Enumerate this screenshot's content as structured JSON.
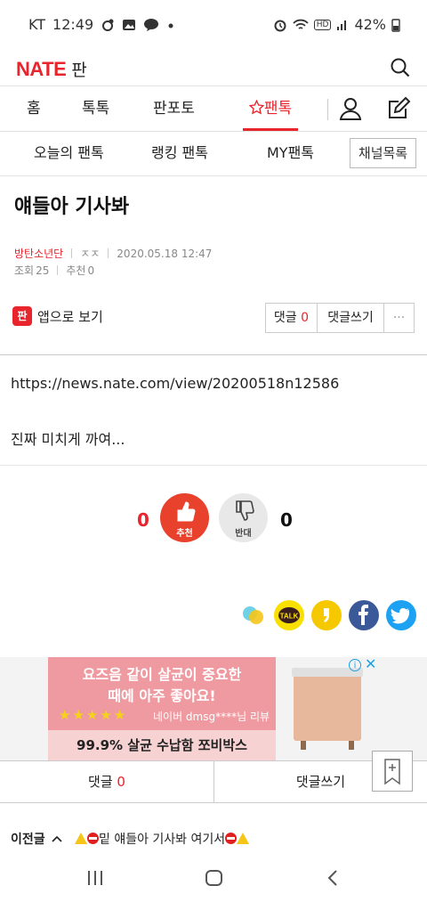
{
  "status_bar": {
    "carrier": "KT",
    "time": "12:49",
    "battery": "42%",
    "hd": "HD"
  },
  "header": {
    "logo": "NATE",
    "section": "판"
  },
  "nav": {
    "tabs": [
      "홈",
      "톡톡",
      "판포토",
      "팬톡"
    ],
    "active": "팬톡"
  },
  "subnav": {
    "tabs": [
      "오늘의 팬톡",
      "랭킹 팬톡",
      "MY팬톡"
    ],
    "channel_button": "채널목록"
  },
  "post": {
    "title": "얘들아 기사봐",
    "author": "방탄소년단",
    "nickname": "ㅈㅈ",
    "datetime": "2020.05.18 12:47",
    "views_label": "조회",
    "views": "25",
    "recommend_label": "추천",
    "recommend": "0",
    "app_view": "앱으로 보기",
    "comment_label": "댓글",
    "comment_count": "0",
    "write_comment": "댓글쓰기",
    "more": "···",
    "url": "https://news.nate.com/view/20200518n12586",
    "text": "진짜 미치게 까여..."
  },
  "votes": {
    "up_count": "0",
    "up_label": "추천",
    "down_count": "0",
    "down_label": "반대"
  },
  "share": {
    "icons": [
      "line-icon",
      "kakaotalk-icon",
      "kakaostory-icon",
      "facebook-icon",
      "twitter-icon"
    ],
    "talk_label": "TALK"
  },
  "ad": {
    "line1": "요즈음 같이 살균이 중요한",
    "line2": "때에 아주 좋아요!",
    "stars": "★★★★★",
    "review": "네이버 dmsg****님 리뷰",
    "line3": "99.9% 살균 수납함 쪼비박스",
    "info": "i",
    "close": "✕"
  },
  "bottom_bar": {
    "comment_label": "댓글",
    "comment_count": "0",
    "write_comment": "댓글쓰기"
  },
  "prev_post": {
    "label": "이전글",
    "title": "밑 얘들아 기사봐 여기서"
  },
  "colors": {
    "accent": "#e8242c",
    "vote_up": "#e8412c"
  }
}
